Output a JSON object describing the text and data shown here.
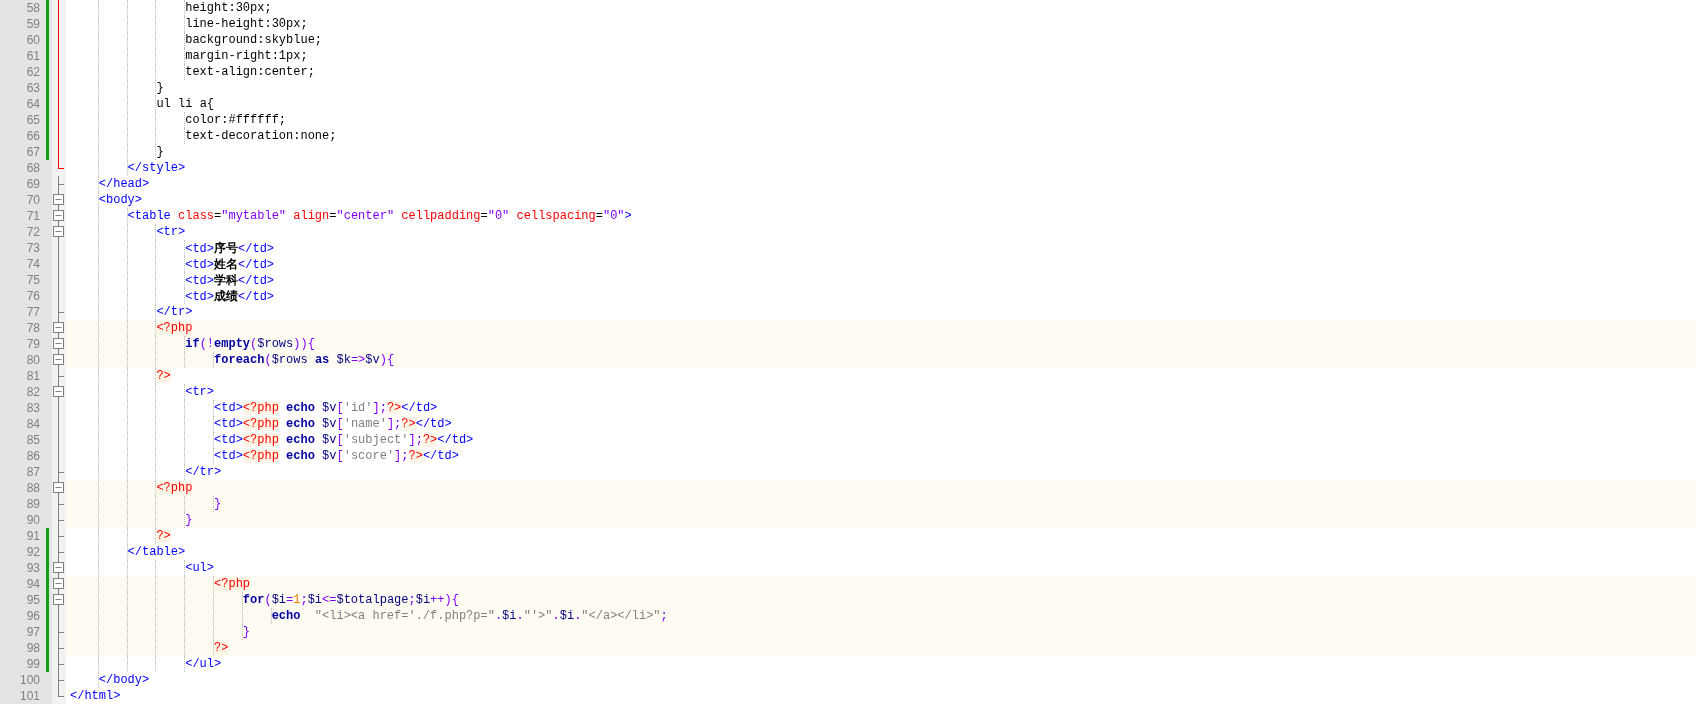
{
  "editor": {
    "lines": [
      {
        "number": "58",
        "changed": true,
        "fold": {
          "kind": "active-mid"
        },
        "php_block": false,
        "tokens": [
          {
            "kind": "css",
            "text": "                height:30px;"
          }
        ]
      },
      {
        "number": "59",
        "changed": true,
        "fold": {
          "kind": "active-mid"
        },
        "php_block": false,
        "tokens": [
          {
            "kind": "css",
            "text": "                line-height:30px;"
          }
        ]
      },
      {
        "number": "60",
        "changed": true,
        "fold": {
          "kind": "active-mid"
        },
        "php_block": false,
        "tokens": [
          {
            "kind": "css",
            "text": "                background:skyblue;"
          }
        ]
      },
      {
        "number": "61",
        "changed": true,
        "fold": {
          "kind": "active-mid"
        },
        "php_block": false,
        "tokens": [
          {
            "kind": "css",
            "text": "                margin-right:1px;"
          }
        ]
      },
      {
        "number": "62",
        "changed": true,
        "fold": {
          "kind": "active-mid"
        },
        "php_block": false,
        "tokens": [
          {
            "kind": "css",
            "text": "                text-align:center;"
          }
        ]
      },
      {
        "number": "63",
        "changed": true,
        "fold": {
          "kind": "active-mid"
        },
        "php_block": false,
        "tokens": [
          {
            "kind": "css",
            "text": "            }"
          }
        ]
      },
      {
        "number": "64",
        "changed": true,
        "fold": {
          "kind": "active-mid"
        },
        "php_block": false,
        "tokens": [
          {
            "kind": "css",
            "text": "            ul li a{"
          }
        ]
      },
      {
        "number": "65",
        "changed": true,
        "fold": {
          "kind": "active-mid"
        },
        "php_block": false,
        "tokens": [
          {
            "kind": "css",
            "text": "                color:#ffffff;"
          }
        ]
      },
      {
        "number": "66",
        "changed": true,
        "fold": {
          "kind": "active-mid"
        },
        "php_block": false,
        "tokens": [
          {
            "kind": "css",
            "text": "                text-decoration:none;"
          }
        ]
      },
      {
        "number": "67",
        "changed": true,
        "fold": {
          "kind": "active-mid"
        },
        "php_block": false,
        "tokens": [
          {
            "kind": "css",
            "text": "            }"
          }
        ]
      },
      {
        "number": "68",
        "changed": false,
        "fold": {
          "kind": "active-end"
        },
        "php_block": false,
        "tokens": [
          {
            "kind": "tag",
            "text": "        </style>"
          }
        ]
      },
      {
        "number": "69",
        "changed": false,
        "fold": {
          "kind": "end"
        },
        "php_block": false,
        "tokens": [
          {
            "kind": "tag",
            "text": "    </head>"
          }
        ]
      },
      {
        "number": "70",
        "changed": false,
        "fold": {
          "kind": "open"
        },
        "php_block": false,
        "tokens": [
          {
            "kind": "tag",
            "text": "    <body>"
          }
        ]
      },
      {
        "number": "71",
        "changed": false,
        "fold": {
          "kind": "open"
        },
        "php_block": false,
        "tokens": [
          {
            "kind": "tag",
            "text": "        <table"
          },
          {
            "kind": "attr",
            "text": " class"
          },
          {
            "kind": "css",
            "text": "="
          },
          {
            "kind": "value",
            "text": "\"mytable\""
          },
          {
            "kind": "attr",
            "text": " align"
          },
          {
            "kind": "css",
            "text": "="
          },
          {
            "kind": "value",
            "text": "\"center\""
          },
          {
            "kind": "attr",
            "text": " cellpadding"
          },
          {
            "kind": "css",
            "text": "="
          },
          {
            "kind": "value",
            "text": "\"0\""
          },
          {
            "kind": "attr",
            "text": " cellspacing"
          },
          {
            "kind": "css",
            "text": "="
          },
          {
            "kind": "value",
            "text": "\"0\""
          },
          {
            "kind": "tag",
            "text": ">"
          }
        ]
      },
      {
        "number": "72",
        "changed": false,
        "fold": {
          "kind": "open"
        },
        "php_block": false,
        "tokens": [
          {
            "kind": "tag",
            "text": "            <tr>"
          }
        ]
      },
      {
        "number": "73",
        "changed": false,
        "fold": {
          "kind": "mid"
        },
        "php_block": false,
        "tokens": [
          {
            "kind": "tag",
            "text": "                <td>"
          },
          {
            "kind": "bold",
            "text": "序号"
          },
          {
            "kind": "tag",
            "text": "</td>"
          }
        ]
      },
      {
        "number": "74",
        "changed": false,
        "fold": {
          "kind": "mid"
        },
        "php_block": false,
        "tokens": [
          {
            "kind": "tag",
            "text": "                <td>"
          },
          {
            "kind": "bold",
            "text": "姓名"
          },
          {
            "kind": "tag",
            "text": "</td>"
          }
        ]
      },
      {
        "number": "75",
        "changed": false,
        "fold": {
          "kind": "mid"
        },
        "php_block": false,
        "tokens": [
          {
            "kind": "tag",
            "text": "                <td>"
          },
          {
            "kind": "bold",
            "text": "学科"
          },
          {
            "kind": "tag",
            "text": "</td>"
          }
        ]
      },
      {
        "number": "76",
        "changed": false,
        "fold": {
          "kind": "mid"
        },
        "php_block": false,
        "tokens": [
          {
            "kind": "tag",
            "text": "                <td>"
          },
          {
            "kind": "bold",
            "text": "成绩"
          },
          {
            "kind": "tag",
            "text": "</td>"
          }
        ]
      },
      {
        "number": "77",
        "changed": false,
        "fold": {
          "kind": "end"
        },
        "php_block": false,
        "tokens": [
          {
            "kind": "tag",
            "text": "            </tr>"
          }
        ]
      },
      {
        "number": "78",
        "changed": false,
        "fold": {
          "kind": "open"
        },
        "php_block": true,
        "tokens": [
          {
            "kind": "php",
            "text": "            <?php"
          }
        ]
      },
      {
        "number": "79",
        "changed": false,
        "fold": {
          "kind": "open"
        },
        "php_block": true,
        "tokens": [
          {
            "kind": "keyword",
            "text": "                if"
          },
          {
            "kind": "operator",
            "text": "(!"
          },
          {
            "kind": "keyword",
            "text": "empty"
          },
          {
            "kind": "operator",
            "text": "("
          },
          {
            "kind": "variable",
            "text": "$rows"
          },
          {
            "kind": "operator",
            "text": ")){"
          }
        ]
      },
      {
        "number": "80",
        "changed": false,
        "fold": {
          "kind": "open"
        },
        "php_block": true,
        "tokens": [
          {
            "kind": "keyword",
            "text": "                    foreach"
          },
          {
            "kind": "operator",
            "text": "("
          },
          {
            "kind": "variable",
            "text": "$rows "
          },
          {
            "kind": "keyword",
            "text": "as"
          },
          {
            "kind": "variable",
            "text": " $k"
          },
          {
            "kind": "operator",
            "text": "=>"
          },
          {
            "kind": "variable",
            "text": "$v"
          },
          {
            "kind": "operator",
            "text": "){"
          }
        ]
      },
      {
        "number": "81",
        "changed": false,
        "fold": {
          "kind": "end"
        },
        "php_block": false,
        "tokens": [
          {
            "kind": "php",
            "text": "            ?>"
          }
        ]
      },
      {
        "number": "82",
        "changed": false,
        "fold": {
          "kind": "open"
        },
        "php_block": false,
        "tokens": [
          {
            "kind": "tag",
            "text": "                <tr>"
          }
        ]
      },
      {
        "number": "83",
        "changed": false,
        "fold": {
          "kind": "mid"
        },
        "php_block": false,
        "tokens": [
          {
            "kind": "tag",
            "text": "                    <td>"
          },
          {
            "kind": "php",
            "text": "<?php"
          },
          {
            "kind": "keyword",
            "text": " echo"
          },
          {
            "kind": "variable",
            "text": " $v"
          },
          {
            "kind": "operator",
            "text": "["
          },
          {
            "kind": "string",
            "text": "'id'"
          },
          {
            "kind": "operator",
            "text": "];"
          },
          {
            "kind": "php",
            "text": "?>"
          },
          {
            "kind": "tag",
            "text": "</td>"
          }
        ]
      },
      {
        "number": "84",
        "changed": false,
        "fold": {
          "kind": "mid"
        },
        "php_block": false,
        "tokens": [
          {
            "kind": "tag",
            "text": "                    <td>"
          },
          {
            "kind": "php",
            "text": "<?php"
          },
          {
            "kind": "keyword",
            "text": " echo"
          },
          {
            "kind": "variable",
            "text": " $v"
          },
          {
            "kind": "operator",
            "text": "["
          },
          {
            "kind": "string",
            "text": "'name'"
          },
          {
            "kind": "operator",
            "text": "];"
          },
          {
            "kind": "php",
            "text": "?>"
          },
          {
            "kind": "tag",
            "text": "</td>"
          }
        ]
      },
      {
        "number": "85",
        "changed": false,
        "fold": {
          "kind": "mid"
        },
        "php_block": false,
        "tokens": [
          {
            "kind": "tag",
            "text": "                    <td>"
          },
          {
            "kind": "php",
            "text": "<?php"
          },
          {
            "kind": "keyword",
            "text": " echo"
          },
          {
            "kind": "variable",
            "text": " $v"
          },
          {
            "kind": "operator",
            "text": "["
          },
          {
            "kind": "string",
            "text": "'subject'"
          },
          {
            "kind": "operator",
            "text": "];"
          },
          {
            "kind": "php",
            "text": "?>"
          },
          {
            "kind": "tag",
            "text": "</td>"
          }
        ]
      },
      {
        "number": "86",
        "changed": false,
        "fold": {
          "kind": "mid"
        },
        "php_block": false,
        "tokens": [
          {
            "kind": "tag",
            "text": "                    <td>"
          },
          {
            "kind": "php",
            "text": "<?php"
          },
          {
            "kind": "keyword",
            "text": " echo"
          },
          {
            "kind": "variable",
            "text": " $v"
          },
          {
            "kind": "operator",
            "text": "["
          },
          {
            "kind": "string",
            "text": "'score'"
          },
          {
            "kind": "operator",
            "text": "];"
          },
          {
            "kind": "php",
            "text": "?>"
          },
          {
            "kind": "tag",
            "text": "</td>"
          }
        ]
      },
      {
        "number": "87",
        "changed": false,
        "fold": {
          "kind": "end"
        },
        "php_block": false,
        "tokens": [
          {
            "kind": "tag",
            "text": "                </tr>"
          }
        ]
      },
      {
        "number": "88",
        "changed": false,
        "fold": {
          "kind": "open"
        },
        "php_block": true,
        "tokens": [
          {
            "kind": "php",
            "text": "            <?php"
          }
        ]
      },
      {
        "number": "89",
        "changed": false,
        "fold": {
          "kind": "end"
        },
        "php_block": true,
        "tokens": [
          {
            "kind": "operator",
            "text": "                    }"
          }
        ]
      },
      {
        "number": "90",
        "changed": false,
        "fold": {
          "kind": "end"
        },
        "php_block": true,
        "tokens": [
          {
            "kind": "operator",
            "text": "                }"
          }
        ]
      },
      {
        "number": "91",
        "changed": true,
        "fold": {
          "kind": "end"
        },
        "php_block": false,
        "tokens": [
          {
            "kind": "php",
            "text": "            ?>"
          }
        ]
      },
      {
        "number": "92",
        "changed": true,
        "fold": {
          "kind": "end"
        },
        "php_block": false,
        "tokens": [
          {
            "kind": "tag",
            "text": "        </table>"
          }
        ]
      },
      {
        "number": "93",
        "changed": true,
        "fold": {
          "kind": "open"
        },
        "php_block": false,
        "tokens": [
          {
            "kind": "tag",
            "text": "                <ul>"
          }
        ]
      },
      {
        "number": "94",
        "changed": true,
        "fold": {
          "kind": "open"
        },
        "php_block": true,
        "tokens": [
          {
            "kind": "php",
            "text": "                    <?php"
          }
        ]
      },
      {
        "number": "95",
        "changed": true,
        "fold": {
          "kind": "open"
        },
        "php_block": true,
        "tokens": [
          {
            "kind": "keyword",
            "text": "                        for"
          },
          {
            "kind": "operator",
            "text": "("
          },
          {
            "kind": "variable",
            "text": "$i"
          },
          {
            "kind": "operator",
            "text": "="
          },
          {
            "kind": "number",
            "text": "1"
          },
          {
            "kind": "operator",
            "text": ";"
          },
          {
            "kind": "variable",
            "text": "$i"
          },
          {
            "kind": "operator",
            "text": "<="
          },
          {
            "kind": "variable",
            "text": "$totalpage"
          },
          {
            "kind": "operator",
            "text": ";"
          },
          {
            "kind": "variable",
            "text": "$i"
          },
          {
            "kind": "operator",
            "text": "++){"
          }
        ]
      },
      {
        "number": "96",
        "changed": true,
        "fold": {
          "kind": "mid"
        },
        "php_block": true,
        "tokens": [
          {
            "kind": "keyword",
            "text": "                            echo"
          },
          {
            "kind": "string",
            "text": "  \"<li><a href='./f.php?p=\""
          },
          {
            "kind": "operator",
            "text": "."
          },
          {
            "kind": "variable",
            "text": "$i"
          },
          {
            "kind": "operator",
            "text": "."
          },
          {
            "kind": "string",
            "text": "\"'>\""
          },
          {
            "kind": "operator",
            "text": "."
          },
          {
            "kind": "variable",
            "text": "$i"
          },
          {
            "kind": "operator",
            "text": "."
          },
          {
            "kind": "string",
            "text": "\"</a></li>\""
          },
          {
            "kind": "operator",
            "text": ";"
          }
        ]
      },
      {
        "number": "97",
        "changed": true,
        "fold": {
          "kind": "end"
        },
        "php_block": true,
        "tokens": [
          {
            "kind": "operator",
            "text": "                        }"
          }
        ]
      },
      {
        "number": "98",
        "changed": true,
        "fold": {
          "kind": "end"
        },
        "php_block": true,
        "tokens": [
          {
            "kind": "php",
            "text": "                    ?>"
          }
        ]
      },
      {
        "number": "99",
        "changed": true,
        "fold": {
          "kind": "end"
        },
        "php_block": false,
        "tokens": [
          {
            "kind": "tag",
            "text": "                </ul>"
          }
        ]
      },
      {
        "number": "100",
        "changed": false,
        "fold": {
          "kind": "end"
        },
        "php_block": false,
        "tokens": [
          {
            "kind": "tag",
            "text": "    </body>"
          }
        ]
      },
      {
        "number": "101",
        "changed": false,
        "fold": {
          "kind": "last"
        },
        "php_block": false,
        "tokens": [
          {
            "kind": "tag",
            "text": "</html>"
          }
        ]
      }
    ]
  }
}
